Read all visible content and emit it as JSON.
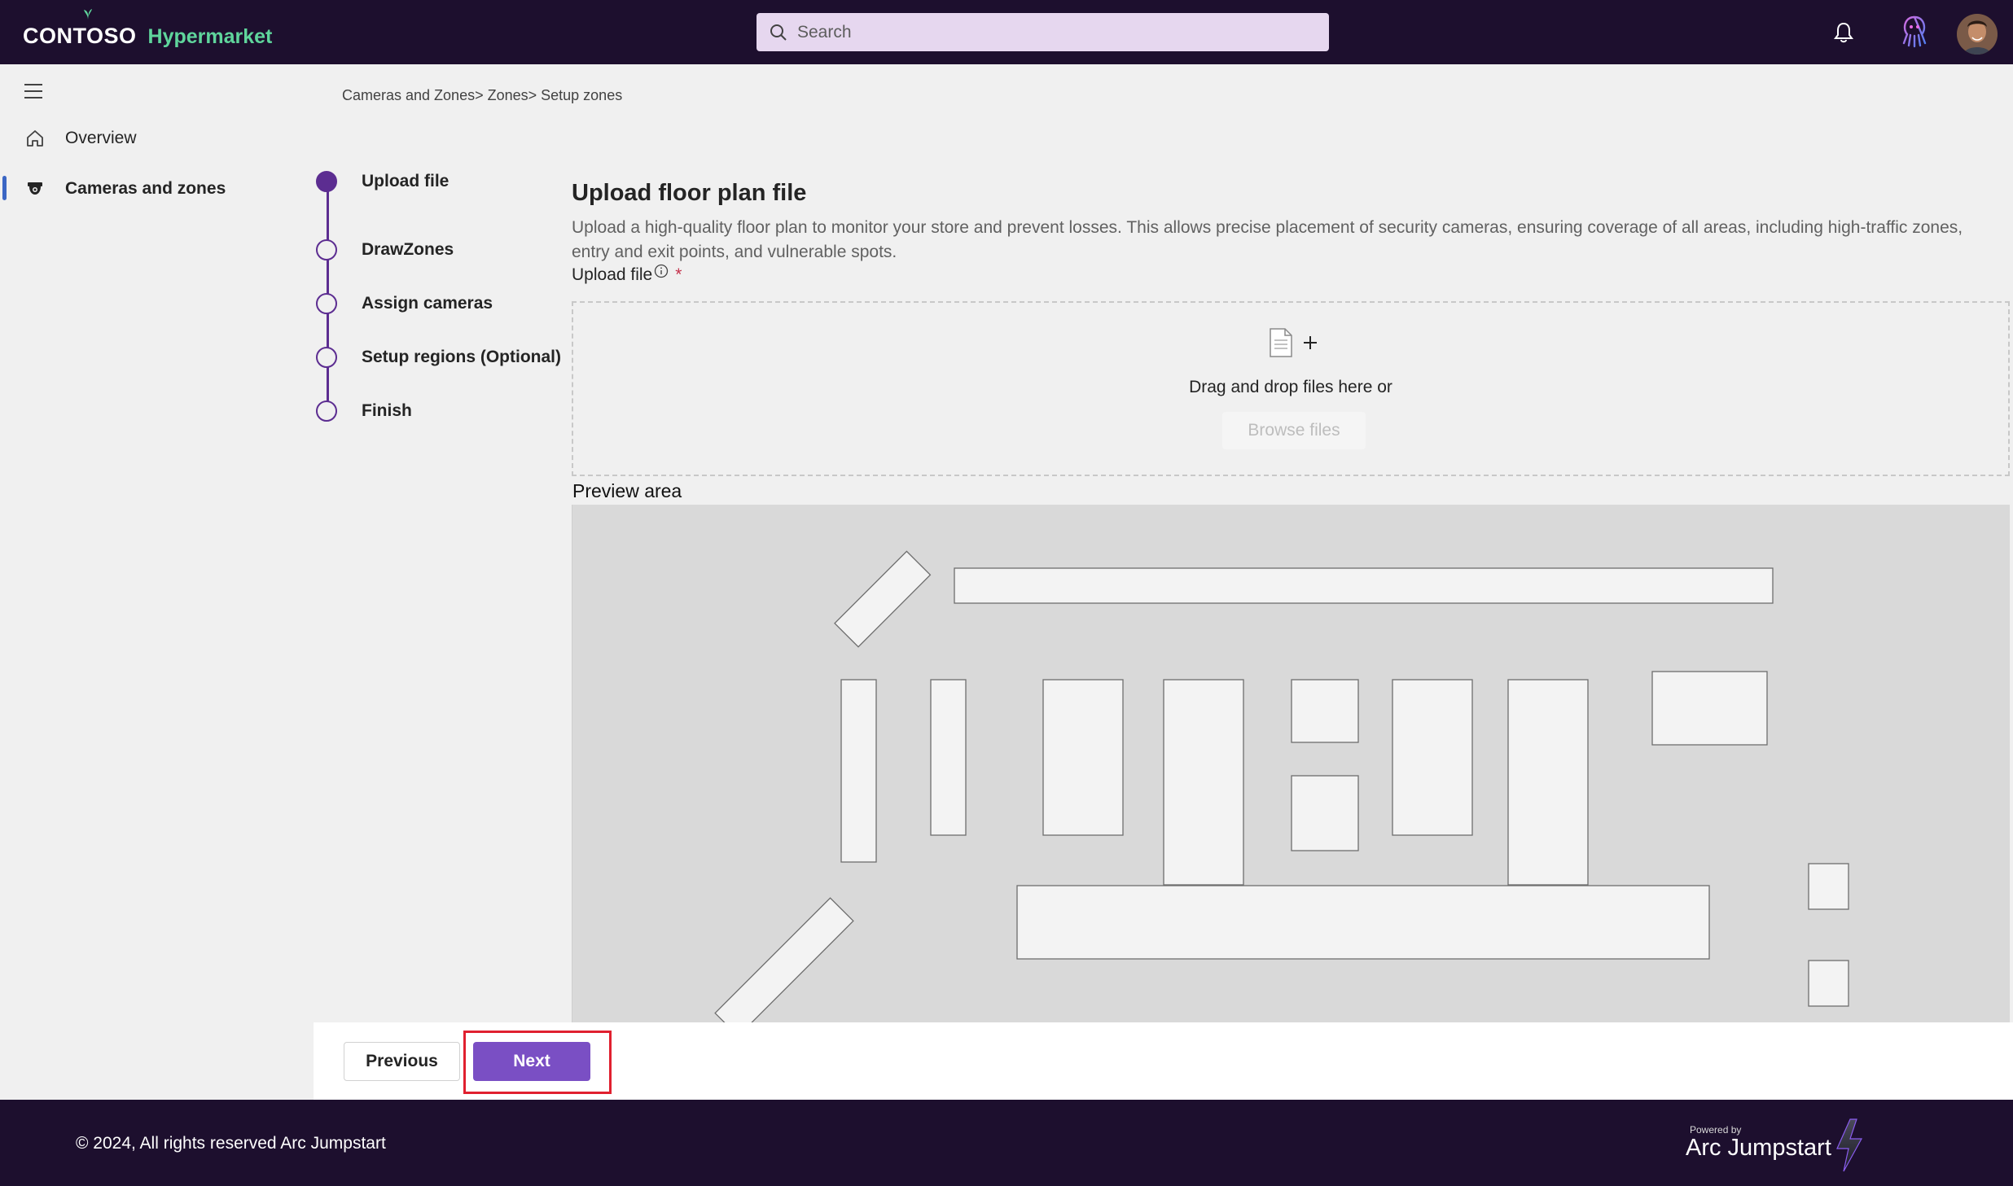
{
  "header": {
    "brand_primary": "CONTOSO",
    "brand_secondary": "Hypermarket",
    "search_placeholder": "Search",
    "icons": [
      "search-icon",
      "bell-icon",
      "octopus-bot-icon",
      "avatar"
    ]
  },
  "sidebar": {
    "items": [
      {
        "label": "Overview",
        "icon": "home-icon",
        "active": false
      },
      {
        "label": "Cameras and zones",
        "icon": "camera-icon",
        "active": true
      }
    ]
  },
  "breadcrumb": "Cameras and Zones> Zones> Setup zones",
  "stepper": {
    "steps": [
      {
        "label": "Upload file",
        "state": "current"
      },
      {
        "label": "DrawZones",
        "state": "pending"
      },
      {
        "label": "Assign cameras",
        "state": "pending"
      },
      {
        "label": "Setup regions (Optional)",
        "state": "pending"
      },
      {
        "label": "Finish",
        "state": "pending"
      }
    ]
  },
  "main": {
    "title": "Upload floor plan file",
    "description": "Upload a high-quality floor plan to monitor your store and prevent losses. This allows precise placement of security cameras, ensuring coverage of all areas, including high-traffic zones, entry and exit points, and vulnerable spots.",
    "upload_label": "Upload file",
    "required_mark": "*",
    "dropzone_text": "Drag and drop files here or",
    "browse_label": "Browse files",
    "preview_label": "Preview area"
  },
  "actions": {
    "previous_label": "Previous",
    "next_label": "Next"
  },
  "footer": {
    "copyright": "© 2024, All rights reserved Arc Jumpstart",
    "powered_small": "Powered by",
    "powered_big": "Arc Jumpstart"
  },
  "colors": {
    "header_bg": "#1d0f2e",
    "brand_accent": "#5fd59c",
    "primary": "#7a4fc4",
    "stepper": "#5c2d91",
    "highlight": "#e0202f"
  }
}
